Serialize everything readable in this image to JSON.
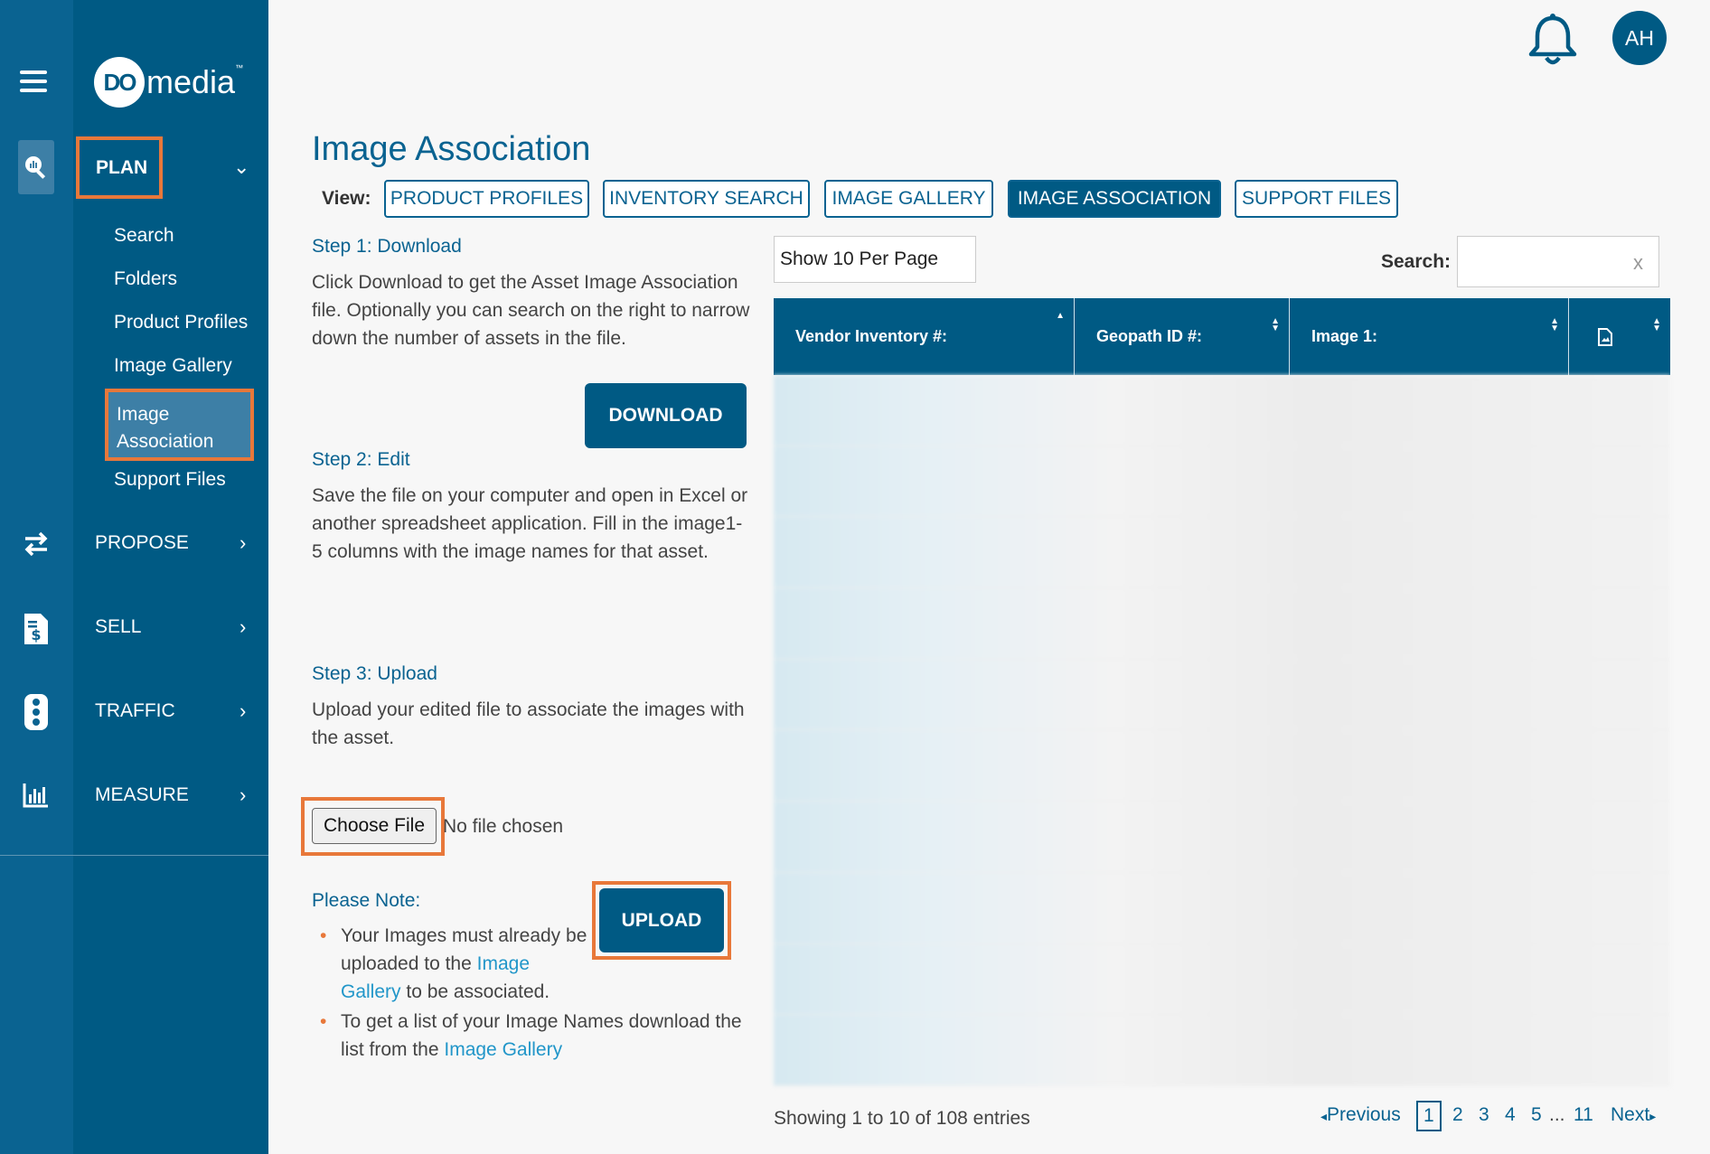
{
  "brand": {
    "logo_mark": "DO",
    "logo_text": "media",
    "logo_tm": "™"
  },
  "nav": {
    "plan": "PLAN",
    "plan_items": [
      "Search",
      "Folders",
      "Product Profiles",
      "Image Gallery",
      "Image\nAssociation",
      "Support Files"
    ],
    "active_item_line1": "Image",
    "active_item_line2": "Association",
    "propose": "PROPOSE",
    "sell": "SELL",
    "traffic": "TRAFFIC",
    "measure": "MEASURE"
  },
  "header": {
    "avatar_initials": "AH"
  },
  "page": {
    "title": "Image Association",
    "view_label": "View:",
    "tabs": [
      "PRODUCT PROFILES",
      "INVENTORY SEARCH",
      "IMAGE GALLERY",
      "IMAGE ASSOCIATION",
      "SUPPORT FILES"
    ],
    "active_tab": "IMAGE ASSOCIATION"
  },
  "steps": {
    "step1_title": "Step 1: Download",
    "step1_text": "Click Download to get the Asset Image Association file. Optionally you can search on the right to narrow down the number of assets in the file.",
    "download_label": "DOWNLOAD",
    "step2_title": "Step 2: Edit",
    "step2_text": "Save the file on your computer and open in Excel or another spreadsheet application. Fill in the image1-5 columns with the image names for that asset.",
    "step3_title": "Step 3: Upload",
    "step3_text": "Upload your edited file to associate the images with the asset.",
    "choose_file_label": "Choose File",
    "file_status": "No file chosen",
    "upload_label": "UPLOAD",
    "note_title": "Please Note:",
    "note1_a": "Your Images must already be uploaded to the ",
    "note1_link": "Image Gallery",
    "note1_b": " to be associated.",
    "note2_a": "To get a list of your Image Names download the list from the ",
    "note2_link": "Image Gallery"
  },
  "table": {
    "per_page": "Show 10 Per Page",
    "search_label": "Search:",
    "search_clear": "x",
    "columns": [
      "Vendor Inventory #:",
      "Geopath ID #:",
      "Image 1:"
    ],
    "showing": "Showing 1 to 10 of 108 entries",
    "pager": {
      "previous": "Previous",
      "pages": [
        "1",
        "2",
        "3",
        "4",
        "5"
      ],
      "ellipsis": "...",
      "last": "11",
      "next": "Next",
      "current": "1"
    }
  }
}
